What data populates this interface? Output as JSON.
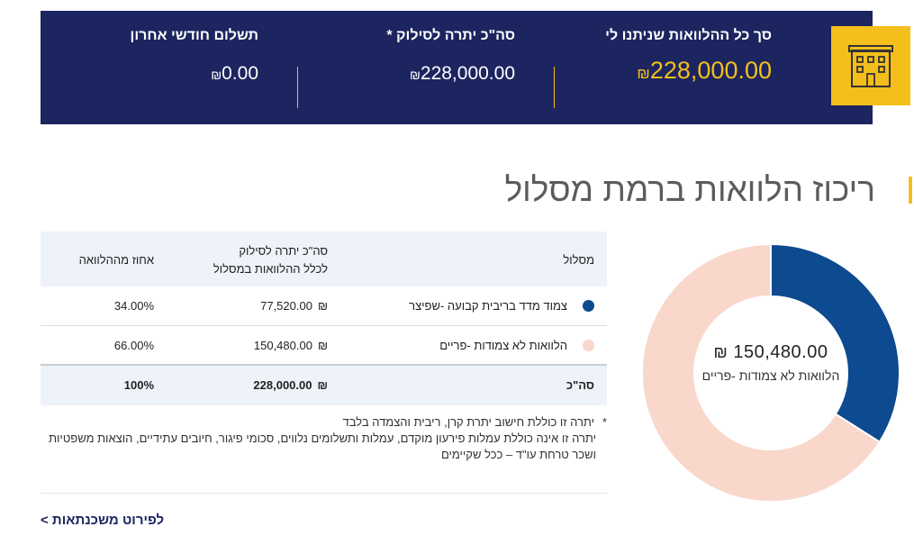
{
  "summary": {
    "icon": "building-icon",
    "total_loans_label": "סך כל ההלוואות שניתנו לי",
    "total_loans_value": "228,000.00",
    "balance_label": "סה\"כ יתרה לסילוק *",
    "balance_value": "228,000.00",
    "last_payment_label": "תשלום חודשי אחרון",
    "last_payment_value": "0.00",
    "currency": "₪"
  },
  "section": {
    "title": "ריכוז הלוואות ברמת מסלול"
  },
  "donut": {
    "center_value": "150,480.00",
    "center_currency": "₪",
    "center_label": "הלוואות לא צמודות -פריים"
  },
  "chart_data": {
    "type": "pie",
    "categories": [
      "צמוד מדד בריבית קבועה -שפיצר",
      "הלוואות לא צמודות -פריים"
    ],
    "values": [
      34.0,
      66.0
    ],
    "colors": [
      "#0d4a8f",
      "#f9d7cb"
    ]
  },
  "table": {
    "headers": {
      "track": "מסלול",
      "balance_line1": "סה\"כ יתרה לסילוק",
      "balance_line2": "לכלל ההלוואות במסלול",
      "percent": "אחוז מההלוואה"
    },
    "rows": [
      {
        "track": "צמוד מדד בריבית קבועה -שפיצר",
        "balance": "77,520.00",
        "percent": "34.00%",
        "color": "#0d4a8f"
      },
      {
        "track": "הלוואות לא צמודות -פריים",
        "balance": "150,480.00",
        "percent": "66.00%",
        "color": "#f9d7cb"
      }
    ],
    "total": {
      "label": "סה\"כ",
      "balance": "228,000.00",
      "percent": "100%"
    },
    "currency": "₪"
  },
  "footnote": {
    "star": "*",
    "line1": "יתרה זו כוללת חישוב יתרת קרן, ריבית והצמדה בלבד",
    "line2": "יתרה זו אינה כוללת עמלות פירעון מוקדם, עמלות ותשלומים נלווים, סכומי פיגור, חיובים עתידיים, הוצאות משפטיות",
    "line3": "ושכר טרחת עו\"ד – ככל שקיימים"
  },
  "links": {
    "mortgage_details": "לפירוט משכנתאות >"
  }
}
